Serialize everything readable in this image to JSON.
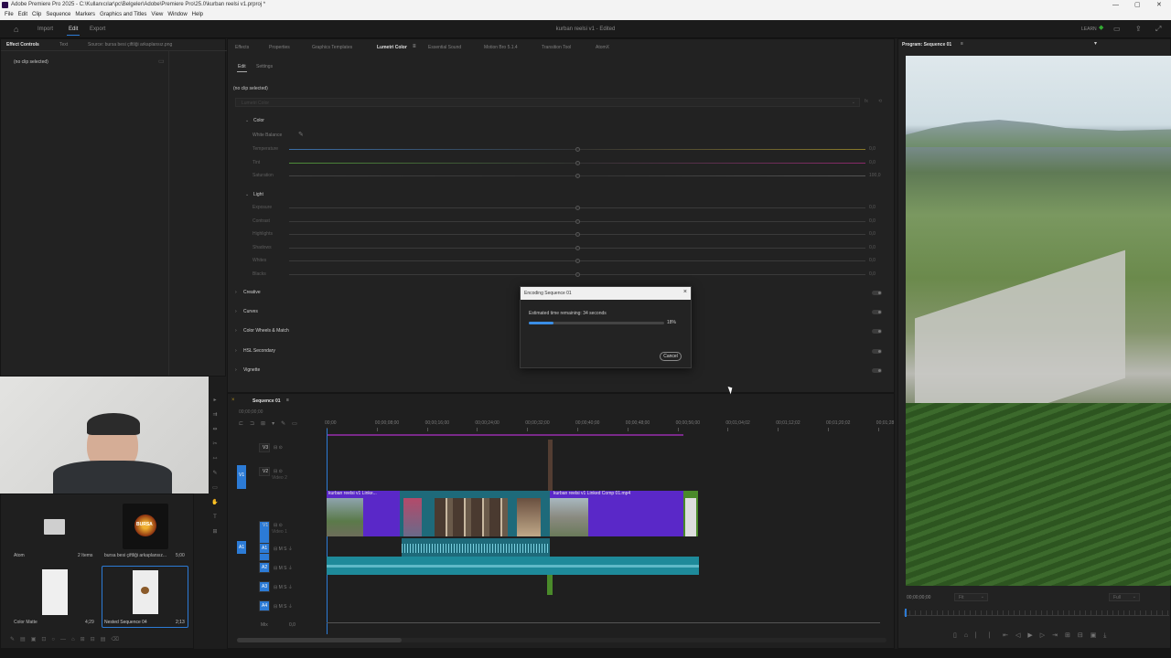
{
  "titlebar": {
    "text": "Adobe Premiere Pro 2025 - C:\\Kullanıcılar\\pc\\Belgeler\\Adobe\\Premiere Pro\\25.0\\kurban reelsi v1.prproj *"
  },
  "menu": [
    "File",
    "Edit",
    "Clip",
    "Sequence",
    "Markers",
    "Graphics and Titles",
    "View",
    "Window",
    "Help"
  ],
  "header": {
    "workspaces": [
      "Import",
      "Edit",
      "Export"
    ],
    "active_workspace": "Edit",
    "doc_title": "kurban reelsi v1 - Edited",
    "learn": "LEARN"
  },
  "effect_controls": {
    "tabs": [
      "Effect Controls",
      "Text",
      "Source: bursa besi çiftliği arkaplansız.png"
    ],
    "empty": "(no clip selected)"
  },
  "lumetri": {
    "tabs": [
      "Effects",
      "Properties",
      "Graphics Templates",
      "Lumetri Color",
      "Essential Sound",
      "Motion Bro 5.1.4",
      "Transition Tool",
      "AtomX"
    ],
    "active_tab": "Lumetri Color",
    "subtabs": [
      "Edit",
      "Settings"
    ],
    "no_clip": "(no clip selected)",
    "preset": "Lumetri Color",
    "color_header": "Color",
    "white_balance": "White Balance",
    "color_sliders": [
      {
        "label": "Temperature",
        "value": "0,0",
        "color": "#3b6fa8"
      },
      {
        "label": "Tint",
        "value": "0,0",
        "color": "#4f8f3a"
      },
      {
        "label": "Saturation",
        "value": "100,0",
        "color": "#444444"
      }
    ],
    "light_header": "Light",
    "light_sliders": [
      {
        "label": "Exposure",
        "value": "0,0"
      },
      {
        "label": "Contrast",
        "value": "0,0"
      },
      {
        "label": "Highlights",
        "value": "0,0"
      },
      {
        "label": "Shadows",
        "value": "0,0"
      },
      {
        "label": "Whites",
        "value": "0,0"
      },
      {
        "label": "Blacks",
        "value": "0,0"
      }
    ],
    "sections": [
      "Creative",
      "Curves",
      "Color Wheels & Match",
      "HSL Secondary",
      "Vignette"
    ]
  },
  "program_monitor": {
    "title": "Program: Sequence 01",
    "timecode": "00;00;00;00",
    "zoom": "Fit",
    "quality": "Full"
  },
  "dialog": {
    "title": "Encoding Sequence 01",
    "message": "Estimated time remaining: 34 seconds",
    "progress": 18,
    "progress_label": "18%",
    "cancel": "Cancel"
  },
  "project": {
    "items": [
      {
        "name": "Atom",
        "meta": "2 Items",
        "kind": "bin"
      },
      {
        "name": "bursa besi çiftliği arkaplansız...",
        "meta": "5;00",
        "kind": "logo"
      },
      {
        "name": "Color Matte",
        "meta": "4;29",
        "kind": "matte"
      },
      {
        "name": "Nested Sequence 04",
        "meta": "2;13",
        "kind": "nested"
      }
    ],
    "logo_text": "BURSA"
  },
  "timeline": {
    "tab": "Sequence 01",
    "timecode": "00;00;00;00",
    "ruler": [
      "00;00",
      "00;00;08;00",
      "00;00;16;00",
      "00;00;24;00",
      "00;00;32;00",
      "00;00;40;00",
      "00;00;48;00",
      "00;00;56;00",
      "00;01;04;02",
      "00;01;12;02",
      "00;01;20;02",
      "00;01;28"
    ],
    "video_tracks": [
      "V3",
      "V2",
      "V1"
    ],
    "video_track_names": {
      "V2": "Video 2",
      "V1": "Video 1"
    },
    "audio_tracks": [
      "A1",
      "A2",
      "A3",
      "A4"
    ],
    "mix": {
      "label": "Mix",
      "value": "0,0"
    },
    "clips": {
      "v1a": "kurban reelsi v1 Linke...",
      "v1b": "kurban reelsi v1 Linked Comp 01.mp4"
    }
  },
  "colors": {
    "accent": "#2c7bd6",
    "clip_purple": "#5a28c8",
    "audio_teal": "#1e8a9a",
    "nested_green": "#4a8a2a"
  }
}
